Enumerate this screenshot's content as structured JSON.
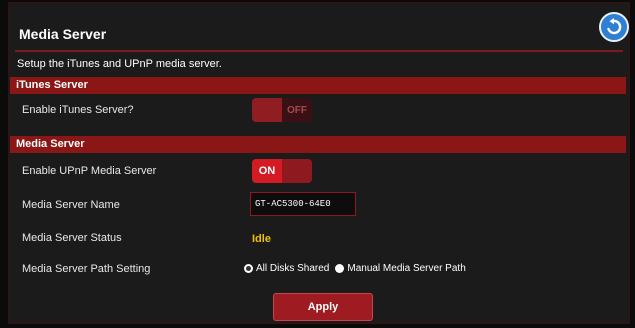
{
  "page": {
    "title": "Media Server",
    "description": "Setup the iTunes and UPnP media server."
  },
  "itunes_section": {
    "header": "iTunes Server",
    "enable_label": "Enable iTunes Server?",
    "toggle_state": "OFF"
  },
  "media_section": {
    "header": "Media Server",
    "upnp_label": "Enable UPnP Media Server",
    "upnp_toggle_state": "ON",
    "name_label": "Media Server Name",
    "name_value": "GT-AC5300-64E0",
    "status_label": "Media Server Status",
    "status_value": "Idle",
    "path_label": "Media Server Path Setting",
    "path_options": [
      "All Disks Shared",
      "Manual Media Server Path"
    ],
    "path_selected": "All Disks Shared"
  },
  "actions": {
    "apply_label": "Apply"
  },
  "icons": {
    "back": "back-arrow-icon"
  },
  "colors": {
    "section_bar": "#8a1616",
    "toggle_on": "#d41b24",
    "status": "#f0c000",
    "back_button": "#2f7fd3"
  }
}
